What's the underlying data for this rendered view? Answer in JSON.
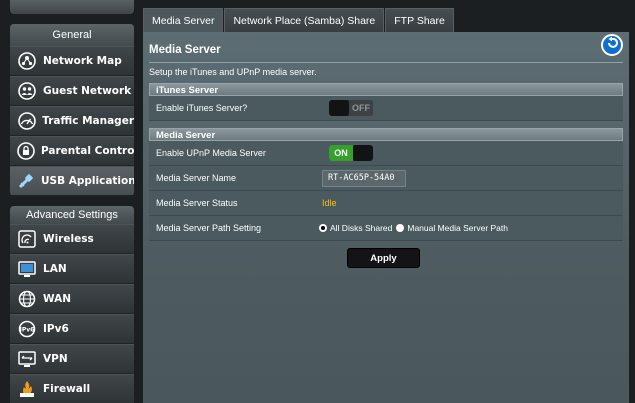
{
  "sidebar": {
    "general": {
      "heading": "General",
      "items": [
        {
          "label": "Network Map",
          "icon": "network-map-icon"
        },
        {
          "label": "Guest Network",
          "icon": "guest-network-icon"
        },
        {
          "label": "Traffic Manager",
          "icon": "traffic-manager-icon"
        },
        {
          "label": "Parental Controls",
          "icon": "parental-controls-icon"
        },
        {
          "label": "USB Application",
          "icon": "usb-application-icon"
        }
      ],
      "active": "USB Application"
    },
    "advanced": {
      "heading": "Advanced Settings",
      "items": [
        {
          "label": "Wireless",
          "icon": "wireless-icon"
        },
        {
          "label": "LAN",
          "icon": "lan-icon"
        },
        {
          "label": "WAN",
          "icon": "wan-icon"
        },
        {
          "label": "IPv6",
          "icon": "ipv6-icon"
        },
        {
          "label": "VPN",
          "icon": "vpn-icon"
        },
        {
          "label": "Firewall",
          "icon": "firewall-icon"
        }
      ]
    }
  },
  "tabs": [
    {
      "label": "Media Server",
      "active": true
    },
    {
      "label": "Network Place (Samba) Share",
      "active": false
    },
    {
      "label": "FTP Share",
      "active": false
    }
  ],
  "page": {
    "title": "Media Server",
    "description": "Setup the iTunes and UPnP media server.",
    "back_icon": "back-arrow-icon"
  },
  "itunes": {
    "heading": "iTunes Server",
    "enable_label": "Enable iTunes Server?",
    "toggle_off": "OFF"
  },
  "media": {
    "heading": "Media Server",
    "upnp_label": "Enable UPnP Media Server",
    "toggle_on": "ON",
    "name_label": "Media Server Name",
    "name_value": "RT-AC65P-54A0",
    "status_label": "Media Server Status",
    "status_value": "Idle",
    "path_label": "Media Server Path Setting",
    "path_options": [
      "All Disks Shared",
      "Manual Media Server Path"
    ],
    "path_selected": "All Disks Shared"
  },
  "apply_label": "Apply",
  "colors": {
    "status_idle": "#ffc000",
    "toggle_on": "#36a02d",
    "back_button": "#0f6fd0"
  }
}
